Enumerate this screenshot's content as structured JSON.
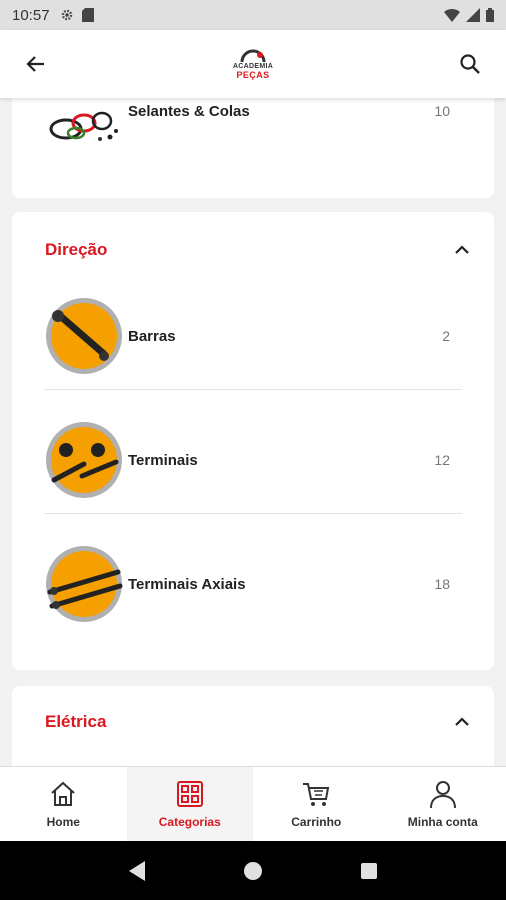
{
  "status_bar": {
    "time": "10:57"
  },
  "app_bar": {
    "logo_top": "ACADEMIA",
    "logo_bottom": "PEÇAS"
  },
  "top_item": {
    "label": "Selantes & Colas",
    "count": "10"
  },
  "sections": [
    {
      "title": "Direção",
      "items": [
        {
          "label": "Barras",
          "count": "2"
        },
        {
          "label": "Terminais",
          "count": "12"
        },
        {
          "label": "Terminais Axiais",
          "count": "18"
        }
      ]
    },
    {
      "title": "Elétrica",
      "items": []
    }
  ],
  "bottom_nav": [
    {
      "label": "Home",
      "icon": "home-icon"
    },
    {
      "label": "Categorias",
      "icon": "grid-icon",
      "active": true
    },
    {
      "label": "Carrinho",
      "icon": "cart-icon"
    },
    {
      "label": "Minha conta",
      "icon": "user-icon"
    }
  ],
  "colors": {
    "accent": "#d9181f",
    "thumb_orange": "#f5a000"
  }
}
